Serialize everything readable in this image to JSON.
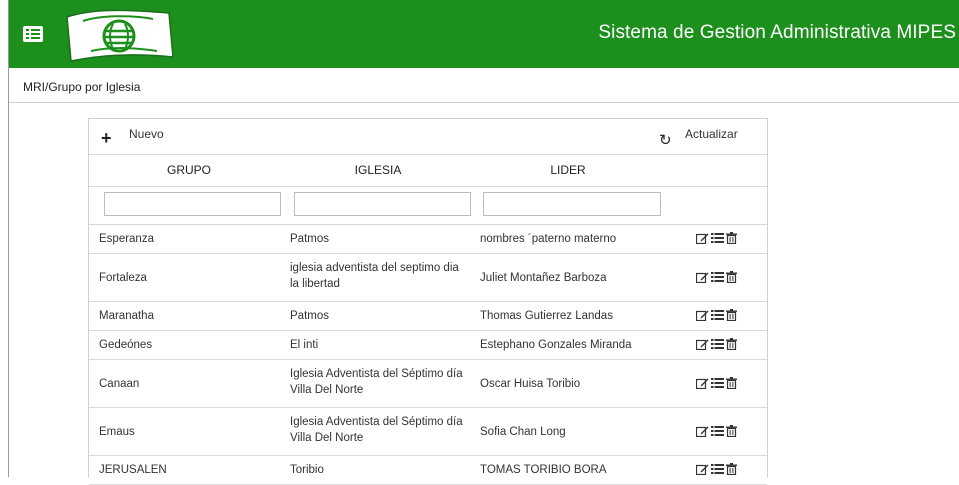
{
  "header": {
    "title": "Sistema de Gestion Administrativa MIPES",
    "color": "#1d8f1d",
    "menu_icon": "list-icon",
    "logo_icon": "open-book-globe-logo"
  },
  "breadcrumb": "MRI/Grupo por Iglesia",
  "toolbar": {
    "new_label": "Nuevo",
    "new_icon": "plus-icon",
    "refresh_label": "Actualizar",
    "refresh_icon": "refresh-icon"
  },
  "table": {
    "columns": [
      "GRUPO",
      "IGLESIA",
      "LIDER"
    ],
    "filters": [
      "",
      "",
      ""
    ],
    "action_icons": [
      "edit-icon",
      "list-icon",
      "trash-icon"
    ],
    "rows": [
      {
        "grupo": "Esperanza",
        "iglesia": [
          "Patmos"
        ],
        "lider": "nombres ´paterno materno"
      },
      {
        "grupo": "Fortaleza",
        "iglesia": [
          "iglesia adventista del septimo dia",
          "la libertad"
        ],
        "lider": "Juliet Montañez Barboza"
      },
      {
        "grupo": "Maranatha",
        "iglesia": [
          "Patmos"
        ],
        "lider": "Thomas Gutierrez Landas"
      },
      {
        "grupo": "Gedeónes",
        "iglesia": [
          "El inti"
        ],
        "lider": "Estephano Gonzales Miranda"
      },
      {
        "grupo": "Canaan",
        "iglesia": [
          "Iglesia Adventista del Séptimo día",
          "Villa Del Norte"
        ],
        "lider": "Oscar Huisa Toribio"
      },
      {
        "grupo": "Emaus",
        "iglesia": [
          "Iglesia Adventista del Séptimo día",
          "Villa Del Norte"
        ],
        "lider": "Sofia Chan Long"
      },
      {
        "grupo": "JERUSALEN",
        "iglesia": [
          "Toribio"
        ],
        "lider": "TOMAS TORIBIO BORA"
      }
    ]
  }
}
